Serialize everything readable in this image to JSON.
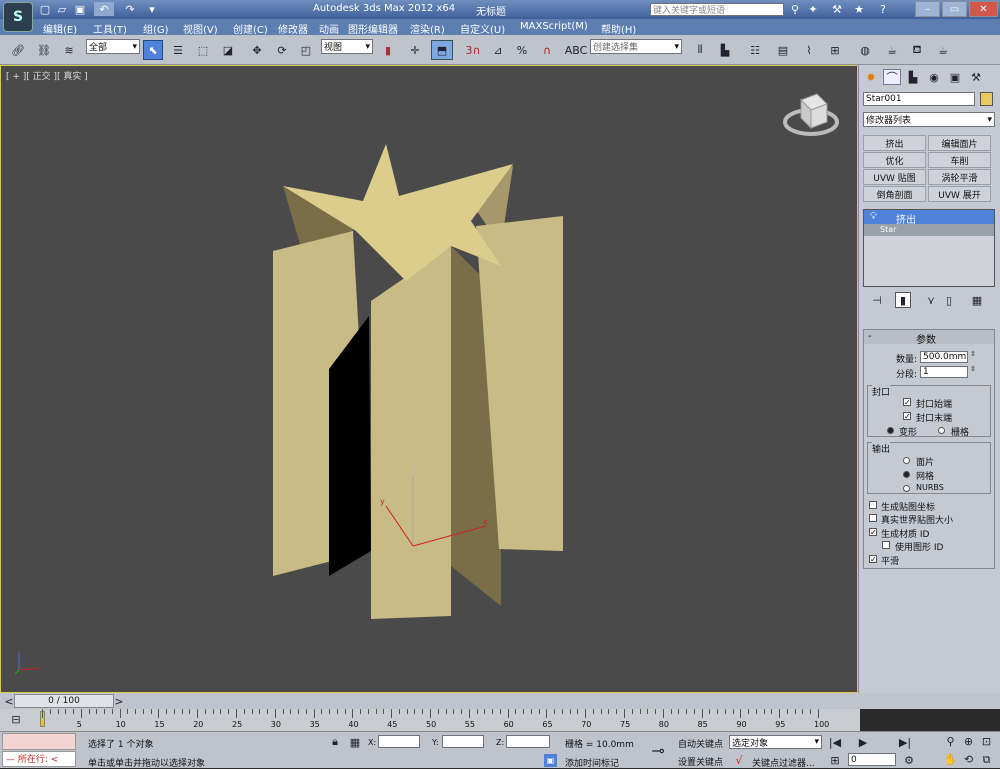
{
  "title": {
    "app": "Autodesk 3ds Max  2012 x64",
    "doc": "无标题",
    "search_placeholder": "键入关键字或短语"
  },
  "menu": [
    "编辑(E)",
    "工具(T)",
    "组(G)",
    "视图(V)",
    "创建(C)",
    "修改器",
    "动画",
    "图形编辑器",
    "渲染(R)",
    "自定义(U)",
    "MAXScript(M)",
    "帮助(H)"
  ],
  "toolbar": {
    "selection_filter": "全部",
    "ref_coord": "视图",
    "named_selection": "创建选择集",
    "snap_labels": [
      "3",
      "%"
    ]
  },
  "viewport": {
    "label": "[ + ][ 正交 ][ 真实 ]",
    "axes": {
      "x": "x",
      "y": "y",
      "z": "z"
    }
  },
  "cmdpanel": {
    "object_name": "Star001",
    "object_color": "#e8c860",
    "modifier_list": "修改器列表",
    "mod_buttons": [
      "挤出",
      "编辑面片",
      "优化",
      "车削",
      "UVW 贴图",
      "涡轮平滑",
      "倒角剖面",
      "UVW 展开"
    ],
    "stack": [
      "挤出",
      "Star"
    ],
    "rollout_title": "参数",
    "amount_label": "数量:",
    "amount": "500.0mm",
    "segments_label": "分段:",
    "segments": "1",
    "capping_title": "封口",
    "cap_start": "封口始端",
    "cap_end": "封口末端",
    "morph": "变形",
    "grid": "栅格",
    "output_title": "输出",
    "out_patch": "面片",
    "out_mesh": "网格",
    "out_nurbs": "NURBS",
    "gen_map": "生成贴图坐标",
    "real_world": "真实世界贴图大小",
    "gen_mat": "生成材质 ID",
    "use_shape": "使用图形 ID",
    "smooth": "平滑"
  },
  "timeline": {
    "frame": "0 / 100",
    "ticks": [
      "5",
      "10",
      "15",
      "20",
      "25",
      "30",
      "35",
      "40",
      "45",
      "50",
      "55",
      "60",
      "65",
      "70",
      "75",
      "80",
      "85",
      "90",
      "95",
      "100"
    ],
    "ticks2": [
      "0"
    ]
  },
  "status": {
    "running": "所在行:",
    "selected": "选择了 1 个对象",
    "prompt": "单击或单击并拖动以选择对象",
    "x": "X:",
    "y": "Y:",
    "z": "Z:",
    "grid": "栅格 = 10.0mm",
    "autokey": "自动关键点",
    "setkey": "设置关键点",
    "selected_obj": "选定对象",
    "key_filter": "关键点过滤器...",
    "add_tag": "添加时间标记",
    "frame_field": "0"
  }
}
